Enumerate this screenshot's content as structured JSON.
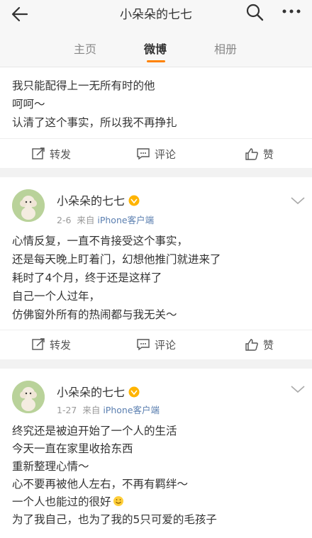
{
  "header": {
    "title": "小朵朵的七七"
  },
  "tabs": [
    {
      "label": "主页",
      "active": false
    },
    {
      "label": "微博",
      "active": true
    },
    {
      "label": "相册",
      "active": false
    }
  ],
  "colors": {
    "accent": "#ff8200",
    "link": "#5b7fb0"
  },
  "actions": {
    "repost": "转发",
    "comment": "评论",
    "like": "赞"
  },
  "posts": [
    {
      "lines": [
        "我只能配得上一无所有时的他",
        "呵呵～",
        "认清了这个事实，所以我不再挣扎"
      ]
    },
    {
      "user": "小朵朵的七七",
      "date": "2-6",
      "source_prefix": "来自",
      "source": "iPhone客户端",
      "lines": [
        "心情反复，一直不肯接受这个事实，",
        "还是每天晚上盯着门，幻想他推门就进来了",
        "耗时了4个月，终于还是这样了",
        "自己一个人过年，",
        "仿佛窗外所有的热闹都与我无关～"
      ]
    },
    {
      "user": "小朵朵的七七",
      "date": "1-27",
      "source_prefix": "来自",
      "source": "iPhone客户端",
      "lines": [
        "终究还是被迫开始了一个人的生活",
        "今天一直在家里收拾东西",
        "重新整理心情～",
        "心不要再被他人左右，不再有羁绊～",
        "一个人也能过的很好",
        "为了我自己，也为了我的5只可爱的毛孩子"
      ]
    }
  ]
}
